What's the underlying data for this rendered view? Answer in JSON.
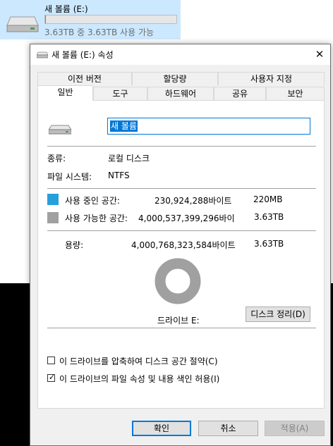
{
  "tile": {
    "name": "새 볼륨 (E:)",
    "info": "3.63TB 중 3.63TB 사용 가능",
    "used_fraction": 0.0001
  },
  "dialog": {
    "title": "새 볼륨 (E:) 속성",
    "close_glyph": "✕"
  },
  "tabs": {
    "row_back": [
      "이전 버전",
      "할당량",
      "사용자 지정"
    ],
    "row_front": [
      "일반",
      "도구",
      "하드웨어",
      "공유",
      "보안"
    ],
    "active": "일반"
  },
  "general": {
    "volume_name": "새 볼륨",
    "type_label": "종류:",
    "type_value": "로컬 디스크",
    "fs_label": "파일 시스템:",
    "fs_value": "NTFS",
    "used_label": "사용 중인 공간:",
    "used_bytes": "230,924,288바이트",
    "used_size": "220MB",
    "free_label": "사용 가능한 공간:",
    "free_bytes": "4,000,537,399,296바이",
    "free_size": "3.63TB",
    "capacity_label": "용량:",
    "capacity_bytes": "4,000,768,323,584바이트",
    "capacity_size": "3.63TB",
    "drive_label": "드라이브 E:",
    "cleanup_button": "디스크 정리(D)",
    "compress_label": "이 드라이브를 압축하여 디스크 공간 절약(C)",
    "compress_checked": false,
    "index_label": "이 드라이브의 파일 속성 및 내용 색인 허용(I)",
    "index_checked": true,
    "used_fraction": 5.77e-05
  },
  "buttons": {
    "ok": "확인",
    "cancel": "취소",
    "apply": "적용(A)"
  },
  "colors": {
    "used": "#26a0da",
    "free": "#a0a0a0",
    "accent": "#0078d7"
  }
}
